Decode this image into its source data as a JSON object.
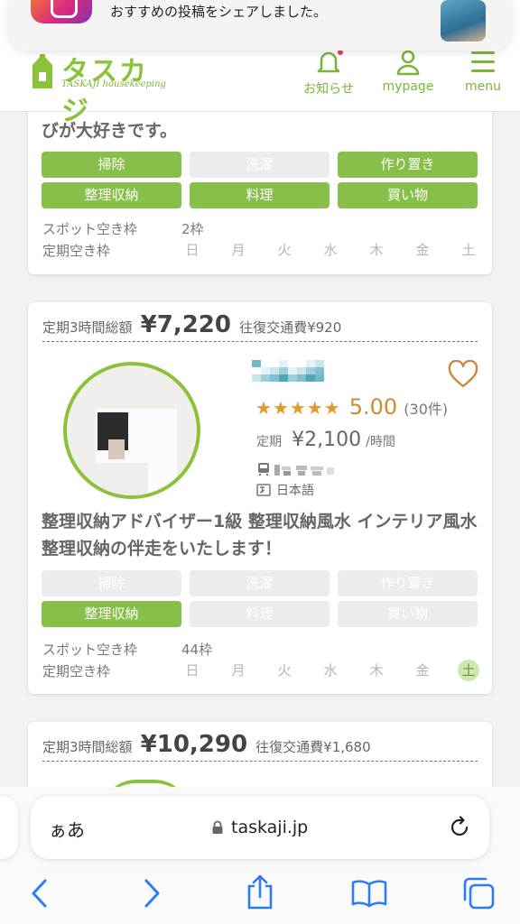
{
  "notification": {
    "text": "おすすめの投稿をシェアしました。"
  },
  "header": {
    "brand": "タスカジ",
    "brand_sub": "TASKAJI  housekeeping",
    "nav": {
      "notifications_label": "お知らせ",
      "mypage_label": "mypage",
      "menu_label": "menu"
    }
  },
  "card1": {
    "tagline_tail": "びが大好きです。",
    "tags": [
      {
        "label": "掃除",
        "on": true
      },
      {
        "label": "洗濯",
        "on": false
      },
      {
        "label": "作り置き",
        "on": true
      },
      {
        "label": "整理収納",
        "on": true
      },
      {
        "label": "料理",
        "on": true
      },
      {
        "label": "買い物",
        "on": true
      }
    ],
    "spot_label": "スポット空き枠",
    "spot_value": "2枠",
    "regular_label": "定期空き枠",
    "days": [
      {
        "label": "日",
        "on": false
      },
      {
        "label": "月",
        "on": false
      },
      {
        "label": "火",
        "on": false
      },
      {
        "label": "水",
        "on": false
      },
      {
        "label": "木",
        "on": false
      },
      {
        "label": "金",
        "on": false
      },
      {
        "label": "土",
        "on": false
      }
    ]
  },
  "card2": {
    "price_label": "定期3時間総額",
    "price": "¥7,220",
    "transport": "往復交通費¥920",
    "rating_stars": "★★★★★",
    "rating_score": "5.00",
    "rating_count": "(30件)",
    "rate_label": "定期",
    "rate_value": "¥2,100",
    "rate_unit": "/時間",
    "language": "日本語",
    "tagline": "整理収納アドバイザー1級 整理収納風水 インテリア風水 整理収納の伴走をいたします！",
    "tags": [
      {
        "label": "掃除",
        "on": false
      },
      {
        "label": "洗濯",
        "on": false
      },
      {
        "label": "作り置き",
        "on": false
      },
      {
        "label": "整理収納",
        "on": true
      },
      {
        "label": "料理",
        "on": false
      },
      {
        "label": "買い物",
        "on": false
      }
    ],
    "spot_label": "スポット空き枠",
    "spot_value": "44枠",
    "regular_label": "定期空き枠",
    "days": [
      {
        "label": "日",
        "on": false
      },
      {
        "label": "月",
        "on": false
      },
      {
        "label": "火",
        "on": false
      },
      {
        "label": "水",
        "on": false
      },
      {
        "label": "木",
        "on": false
      },
      {
        "label": "金",
        "on": false
      },
      {
        "label": "土",
        "on": true
      }
    ]
  },
  "card3": {
    "price_label": "定期3時間総額",
    "price": "¥10,290",
    "transport": "往復交通費¥1,680"
  },
  "browser": {
    "text_size_label": "ぁあ",
    "domain": "taskaji.jp"
  },
  "colors": {
    "brand_green": "#8ac23c",
    "tag_on": "#87bf4a",
    "star": "#e29a2e",
    "ios_blue": "#2f7bf5"
  }
}
